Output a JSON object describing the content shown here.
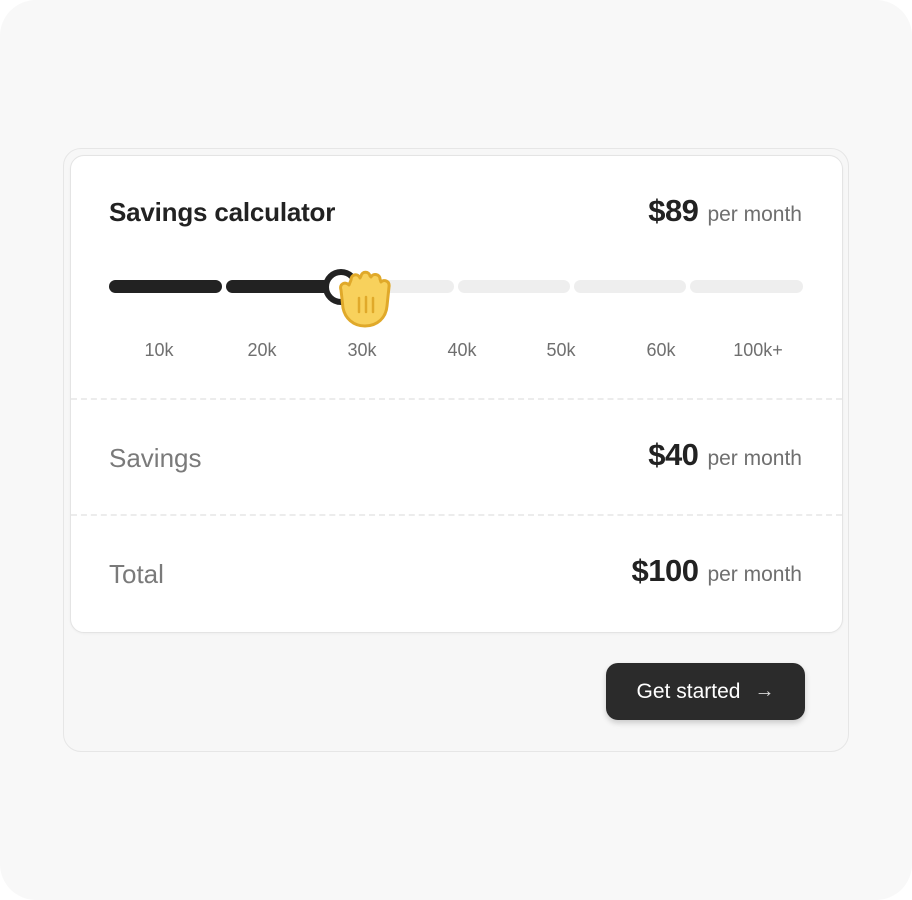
{
  "calculator": {
    "title": "Savings calculator",
    "price": {
      "amount": "$89",
      "unit": "per month"
    },
    "slider": {
      "ticks": [
        "10k",
        "20k",
        "30k",
        "40k",
        "50k",
        "60k",
        "100k+"
      ],
      "value_label": "30k",
      "fill_color": "#222222",
      "track_color": "#eeeeee"
    }
  },
  "rows": [
    {
      "label": "Savings",
      "amount": "$40",
      "unit": "per month"
    },
    {
      "label": "Total",
      "amount": "$100",
      "unit": "per month"
    }
  ],
  "cta": {
    "label": "Get started",
    "icon": "arrow-right-icon"
  },
  "cursor": {
    "icon": "grab-hand-icon"
  }
}
